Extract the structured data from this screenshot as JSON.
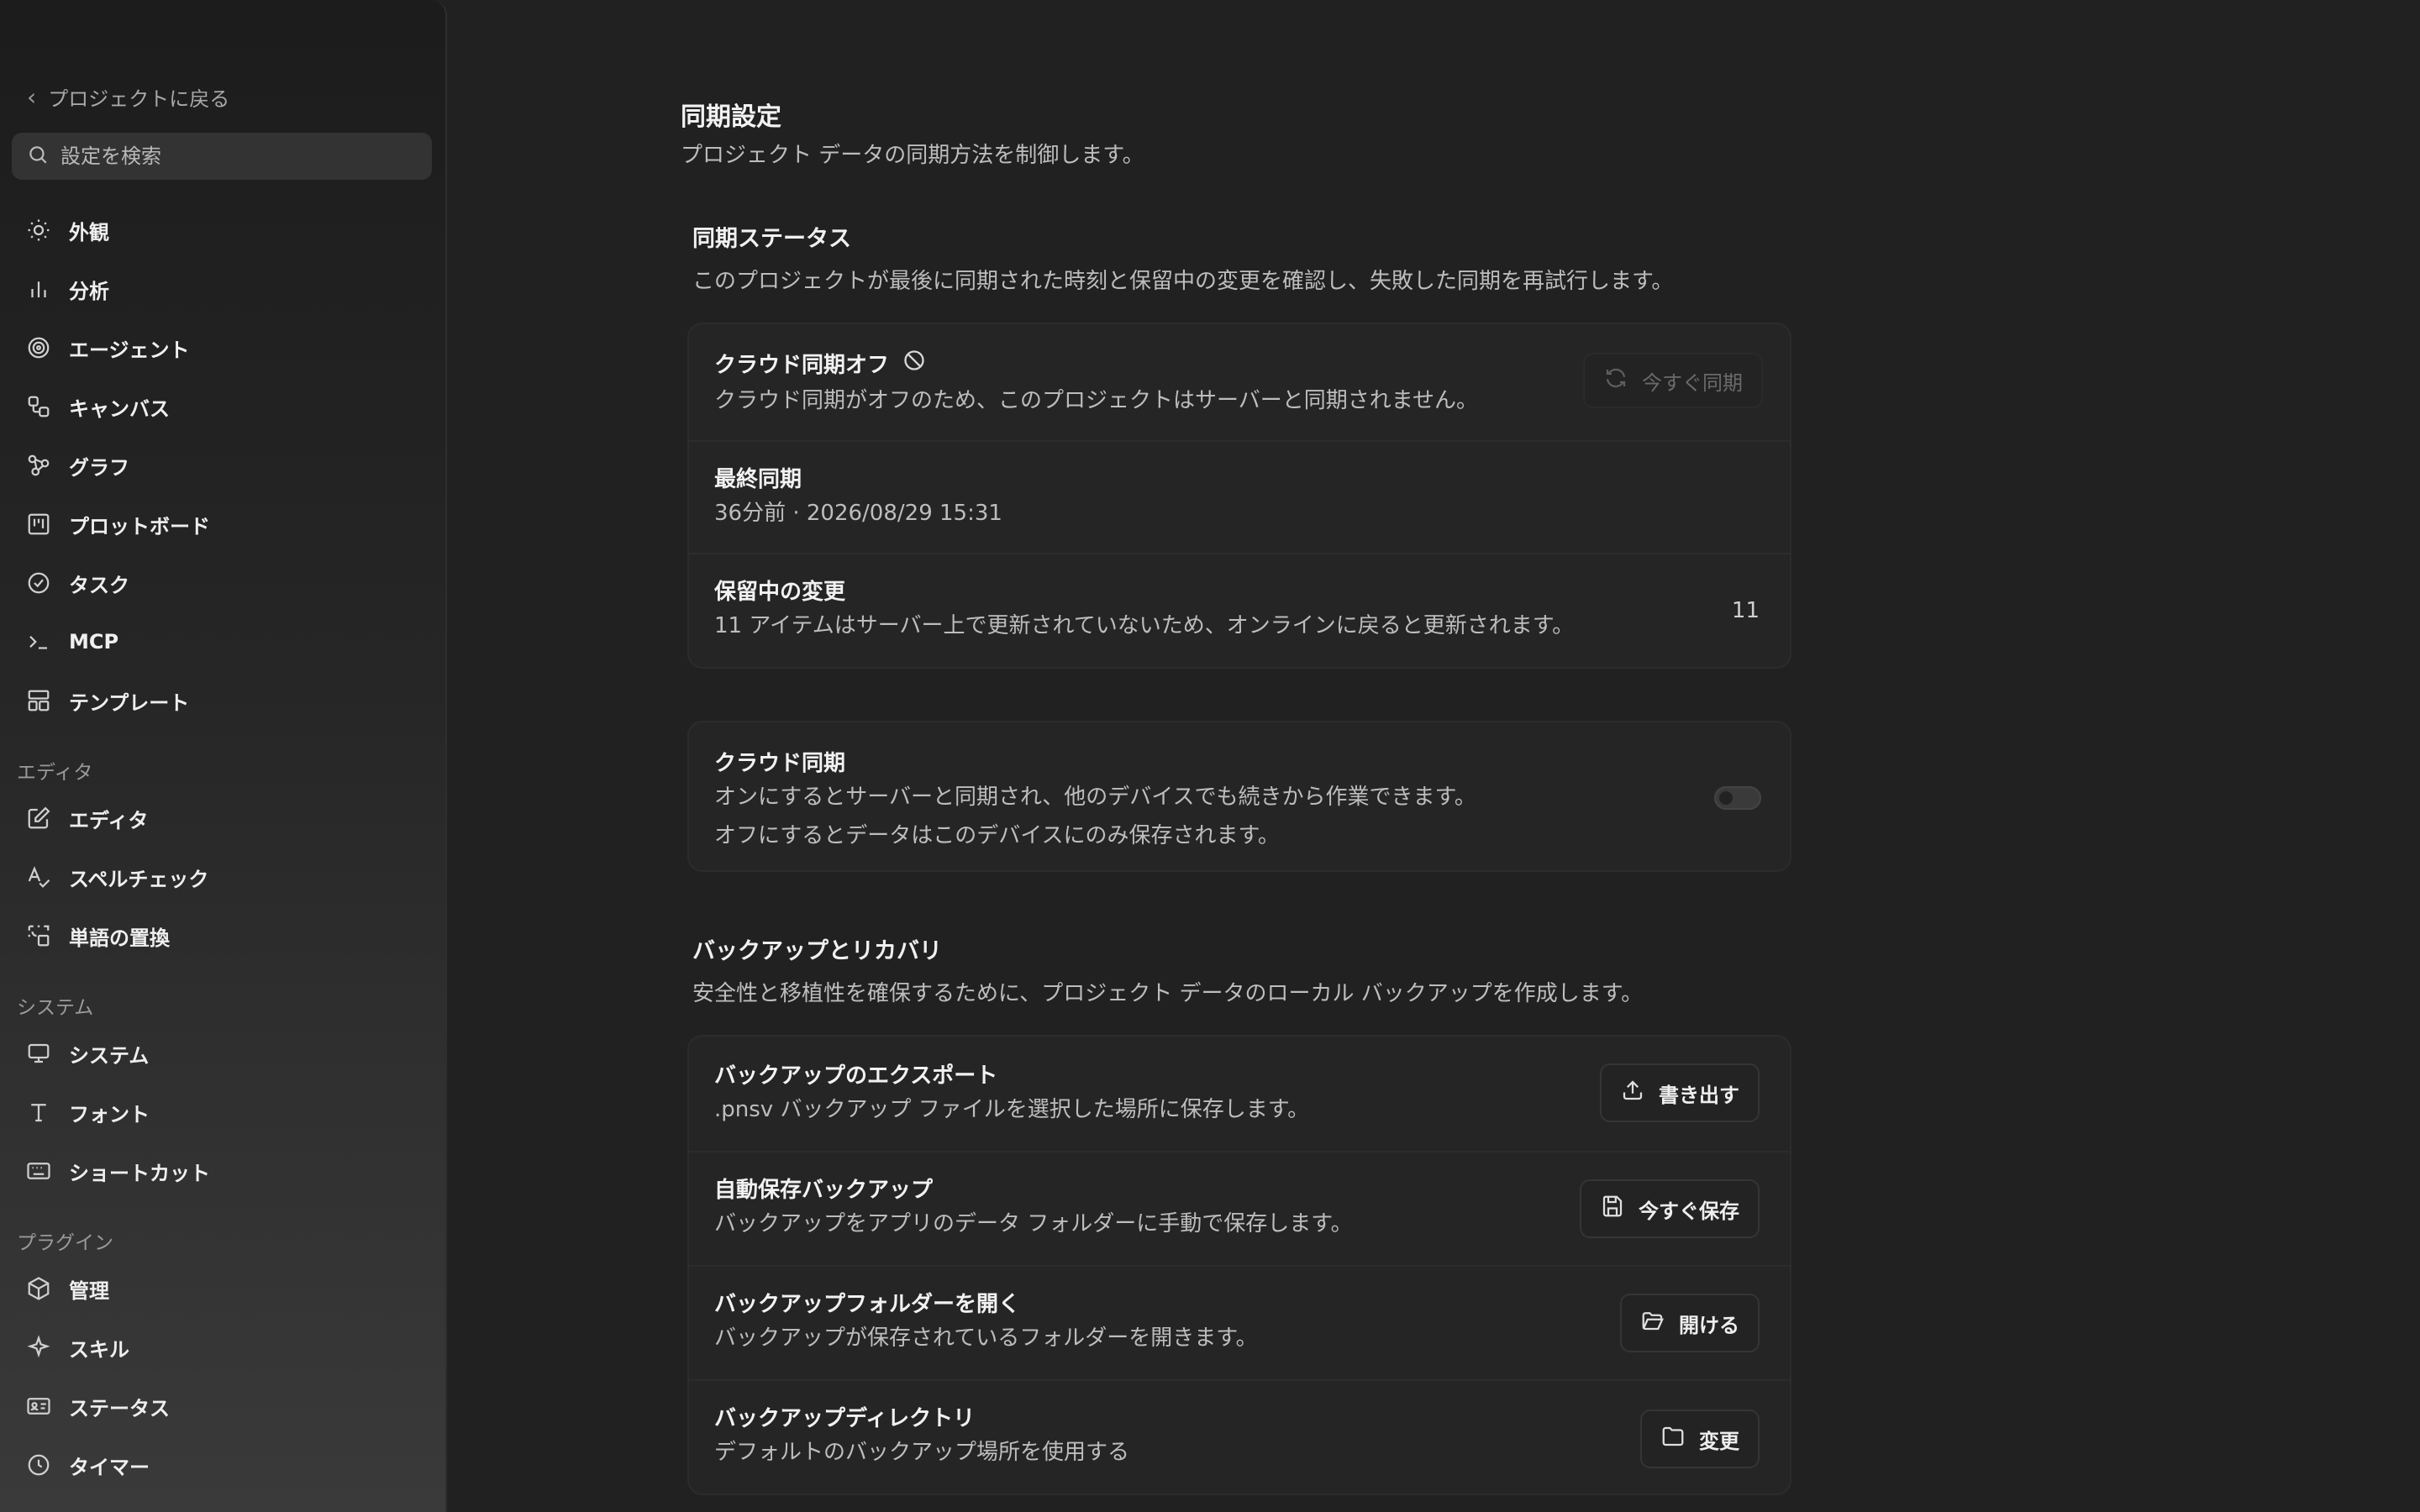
{
  "sidebar": {
    "back_label": "プロジェクトに戻る",
    "search_placeholder": "設定を検索",
    "items": [
      {
        "label": "外観",
        "icon": "sun-icon"
      },
      {
        "label": "分析",
        "icon": "bar-chart-icon"
      },
      {
        "label": "エージェント",
        "icon": "spiral-icon"
      },
      {
        "label": "キャンバス",
        "icon": "canvas-icon"
      },
      {
        "label": "グラフ",
        "icon": "graph-icon"
      },
      {
        "label": "プロットボード",
        "icon": "kanban-icon"
      },
      {
        "label": "タスク",
        "icon": "check-circle-icon"
      },
      {
        "label": "MCP",
        "icon": "terminal-icon"
      },
      {
        "label": "テンプレート",
        "icon": "layout-icon"
      }
    ],
    "section_editor": "エディタ",
    "editor_items": [
      {
        "label": "エディタ",
        "icon": "edit-icon"
      },
      {
        "label": "スペルチェック",
        "icon": "spellcheck-icon"
      },
      {
        "label": "単語の置換",
        "icon": "replace-icon"
      }
    ],
    "section_system": "システム",
    "system_items": [
      {
        "label": "システム",
        "icon": "monitor-icon"
      },
      {
        "label": "フォント",
        "icon": "type-icon"
      },
      {
        "label": "ショートカット",
        "icon": "keyboard-icon"
      }
    ],
    "section_plugins": "プラグイン",
    "plugin_items": [
      {
        "label": "管理",
        "icon": "box-icon"
      },
      {
        "label": "スキル",
        "icon": "sparkle-icon"
      },
      {
        "label": "ステータス",
        "icon": "id-card-icon"
      },
      {
        "label": "タイマー",
        "icon": "clock-icon"
      }
    ]
  },
  "main": {
    "title": "同期設定",
    "subtitle": "プロジェクト データの同期方法を制御します。",
    "sync_status": {
      "title": "同期ステータス",
      "desc": "このプロジェクトが最後に同期された時刻と保留中の変更を確認し、失敗した同期を再試行します。",
      "cloud_off_title": "クラウド同期オフ",
      "cloud_off_desc": "クラウド同期がオフのため、このプロジェクトはサーバーと同期されません。",
      "sync_now_label": "今すぐ同期",
      "last_sync_title": "最終同期",
      "last_sync_value": "36分前 · 2026/08/29 15:31",
      "pending_title": "保留中の変更",
      "pending_desc": "11 アイテムはサーバー上で更新されていないため、オンラインに戻ると更新されます。",
      "pending_count": "11"
    },
    "cloud_sync": {
      "title": "クラウド同期",
      "desc1": "オンにするとサーバーと同期され、他のデバイスでも続きから作業できます。",
      "desc2": "オフにするとデータはこのデバイスにのみ保存されます。",
      "enabled": false
    },
    "backup": {
      "title": "バックアップとリカバリ",
      "desc": "安全性と移植性を確保するために、プロジェクト データのローカル バックアップを作成します。",
      "rows": [
        {
          "title": "バックアップのエクスポート",
          "desc": ".pnsv バックアップ ファイルを選択した場所に保存します。",
          "button": "書き出す"
        },
        {
          "title": "自動保存バックアップ",
          "desc": "バックアップをアプリのデータ フォルダーに手動で保存します。",
          "button": "今すぐ保存"
        },
        {
          "title": "バックアップフォルダーを開く",
          "desc": "バックアップが保存されているフォルダーを開きます。",
          "button": "開ける"
        },
        {
          "title": "バックアップディレクトリ",
          "desc": "デフォルトのバックアップ場所を使用する",
          "button": "変更"
        }
      ]
    }
  }
}
